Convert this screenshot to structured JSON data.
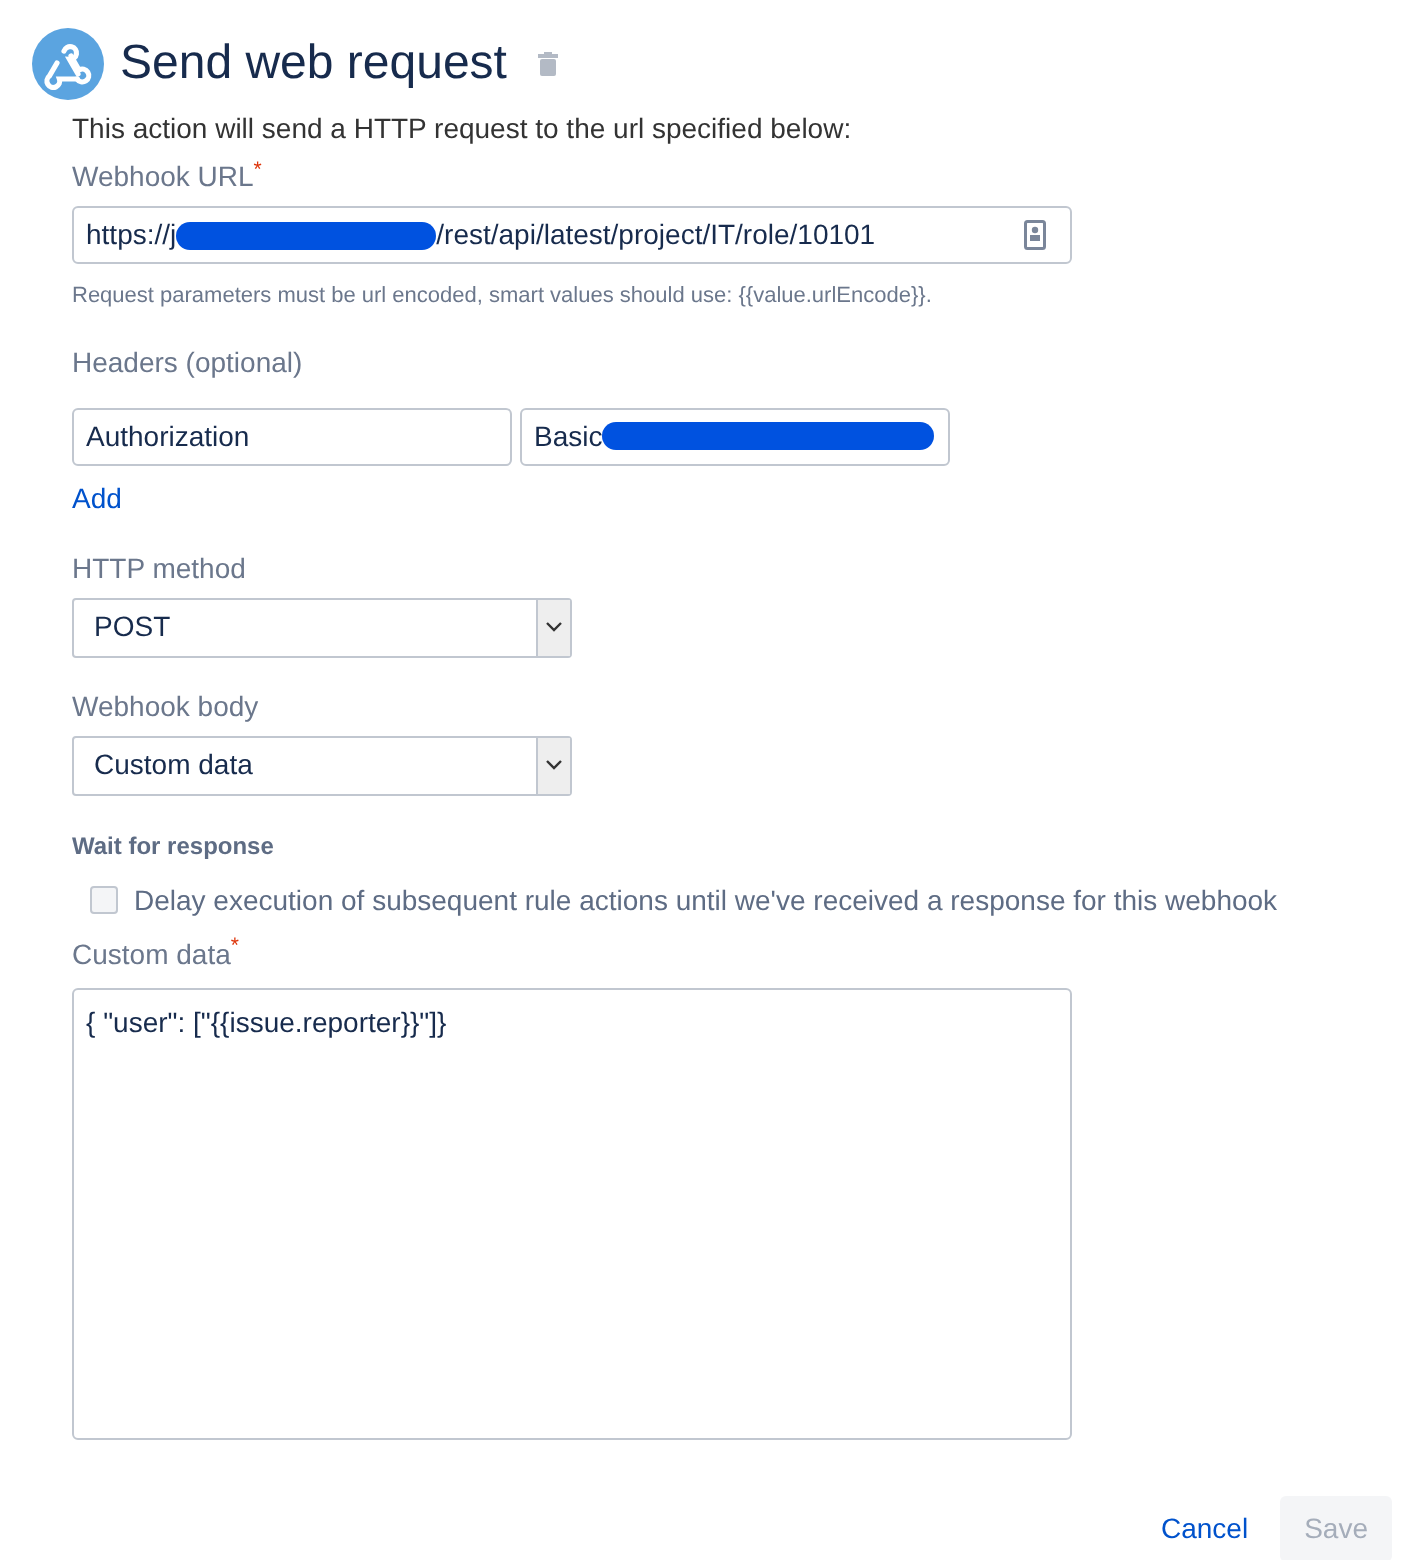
{
  "title": "Send web request",
  "intro": "This action will send a HTTP request to the url specified below:",
  "webhook_url": {
    "label": "Webhook URL",
    "required_mark": "*",
    "value_start": "https://j",
    "redacted": true,
    "value_end": "/rest/api/latest/project/IT/role/10101"
  },
  "url_help": {
    "text": "Request parameters must be url encoded, smart values should use: ",
    "code": "{{value.urlEncode}}."
  },
  "headers": {
    "label": "Headers (optional)",
    "rows": [
      {
        "name": "Authorization",
        "value": "Basic ",
        "redacted": true
      }
    ],
    "add_link": "Add"
  },
  "http_method": {
    "label": "HTTP method",
    "value": "POST"
  },
  "webhook_body": {
    "label": "Webhook body",
    "value": "Custom data"
  },
  "wait": {
    "heading": "Wait for response",
    "label": "Delay execution of subsequent rule actions until we've received a response for this webhook",
    "checked": false
  },
  "custom_data": {
    "label": "Custom data",
    "required_mark": "*",
    "value": "{ \"user\": [\"{{issue.reporter}}\"]}"
  },
  "buttons": [
    {
      "kind": "link",
      "label": "Cancel",
      "disabled": false
    },
    {
      "kind": "button",
      "label": "Save",
      "disabled": true
    }
  ]
}
